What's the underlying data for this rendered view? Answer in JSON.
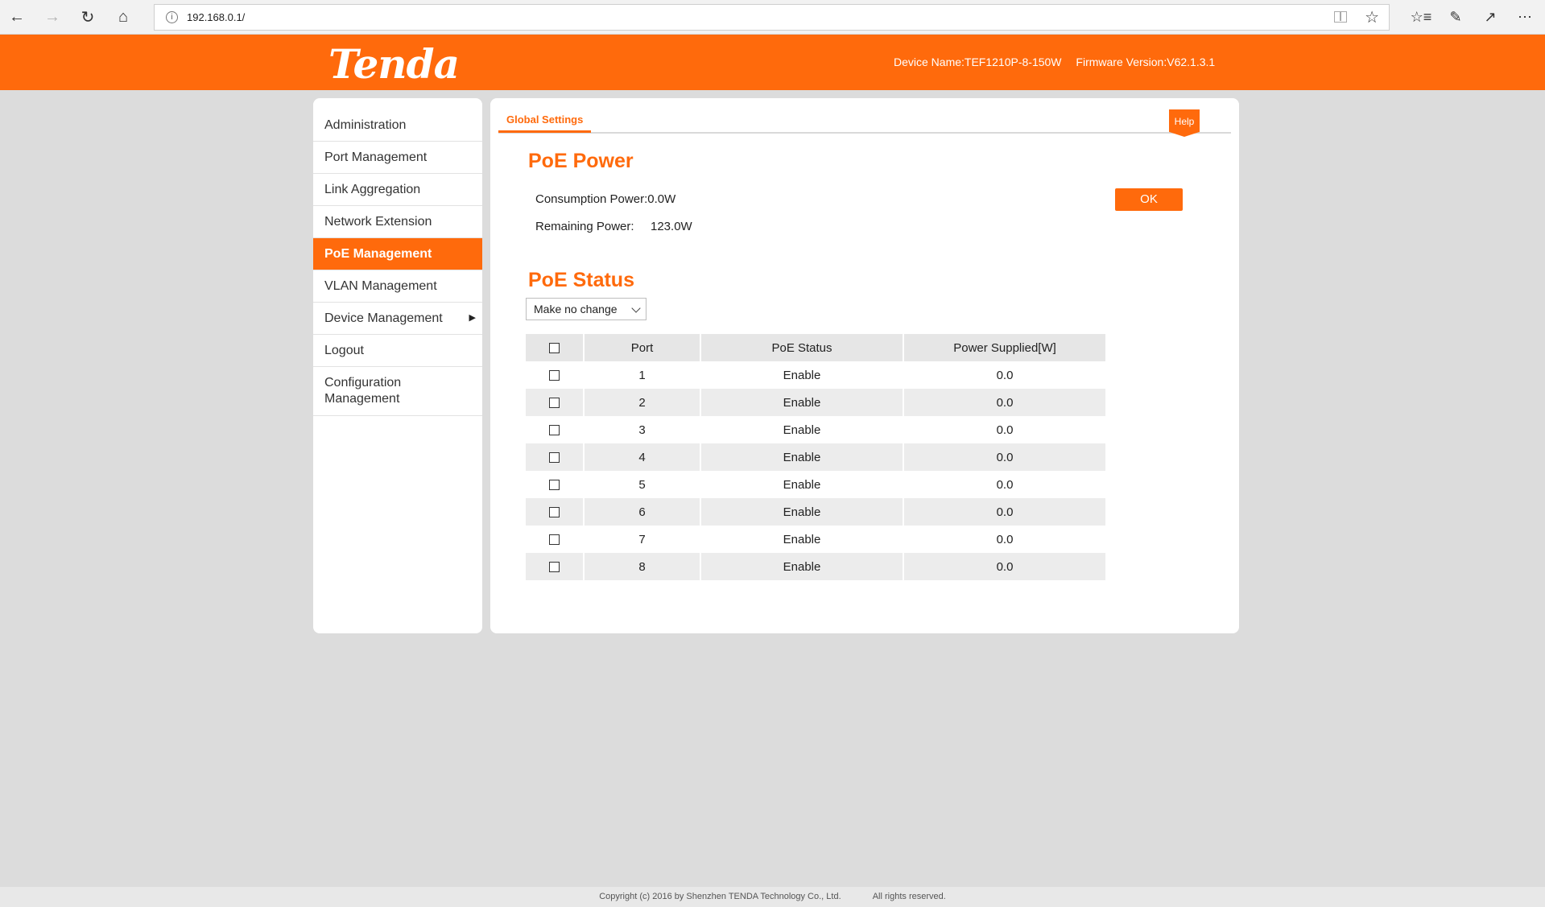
{
  "browser": {
    "url": "192.168.0.1/"
  },
  "header": {
    "logo_text": "Tenda",
    "device_name": "Device Name:TEF1210P-8-150W",
    "firmware_version": "Firmware Version:V62.1.3.1"
  },
  "sidebar": {
    "items": [
      {
        "label": "Administration"
      },
      {
        "label": "Port Management"
      },
      {
        "label": "Link Aggregation"
      },
      {
        "label": "Network Extension"
      },
      {
        "label": "PoE Management",
        "active": true
      },
      {
        "label": "VLAN Management"
      },
      {
        "label": "Device Management",
        "has_submenu": true
      },
      {
        "label": "Logout"
      },
      {
        "label": "Configuration Management"
      }
    ]
  },
  "main": {
    "tab_label": "Global Settings",
    "help_label": "Help",
    "poe_power": {
      "title": "PoE Power",
      "consumption_label": "Consumption Power:",
      "consumption_value": "0.0W",
      "remaining_label": "Remaining Power:",
      "remaining_value": "123.0W",
      "ok_label": "OK"
    },
    "poe_status": {
      "title": "PoE Status",
      "select_value": "Make no change",
      "columns": [
        "Port",
        "PoE Status",
        "Power Supplied[W]"
      ],
      "rows": [
        {
          "port": "1",
          "status": "Enable",
          "power": "0.0"
        },
        {
          "port": "2",
          "status": "Enable",
          "power": "0.0"
        },
        {
          "port": "3",
          "status": "Enable",
          "power": "0.0"
        },
        {
          "port": "4",
          "status": "Enable",
          "power": "0.0"
        },
        {
          "port": "5",
          "status": "Enable",
          "power": "0.0"
        },
        {
          "port": "6",
          "status": "Enable",
          "power": "0.0"
        },
        {
          "port": "7",
          "status": "Enable",
          "power": "0.0"
        },
        {
          "port": "8",
          "status": "Enable",
          "power": "0.0"
        }
      ]
    }
  },
  "footer": {
    "copyright": "Copyright (c) 2016 by Shenzhen TENDA Technology Co., Ltd.",
    "rights": "All rights reserved."
  },
  "colors": {
    "brand": "#ff6a0c",
    "page_bg": "#dcdcdc"
  }
}
